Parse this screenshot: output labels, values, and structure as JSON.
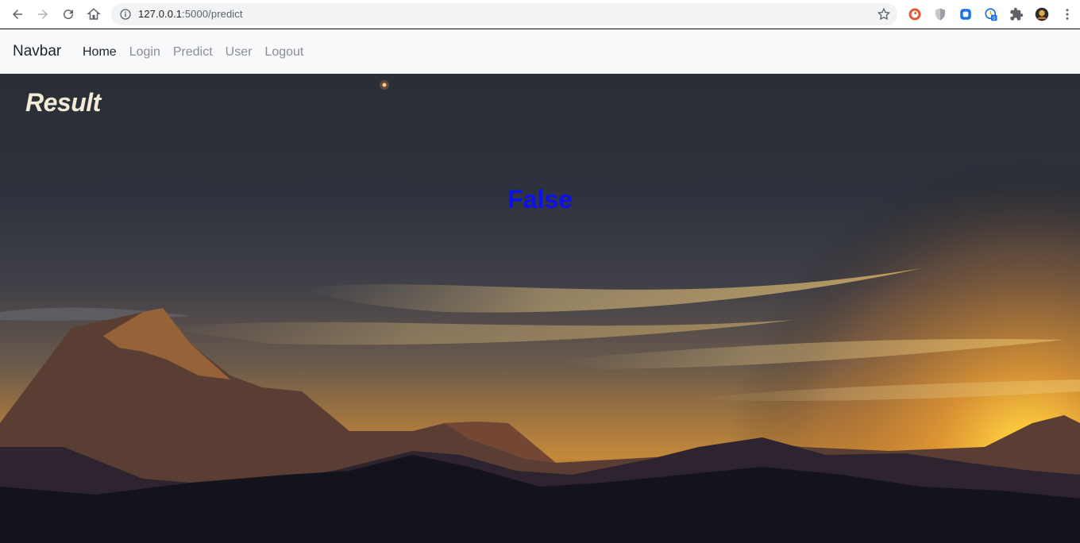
{
  "browser": {
    "url_host": "127.0.0.1",
    "url_path": ":5000/predict",
    "icons": {
      "back": "arrow-left-icon",
      "forward": "arrow-right-icon",
      "reload": "reload-icon",
      "home": "home-icon",
      "info": "info-icon",
      "bookmark": "star-icon"
    },
    "extensions": [
      "duckduckgo-icon",
      "shield-icon",
      "extension-blue-icon",
      "clock-badge-icon",
      "puzzle-icon",
      "avatar",
      "more-icon"
    ],
    "ext_badge": "0"
  },
  "navbar": {
    "brand": "Navbar",
    "links": [
      {
        "label": "Home",
        "active": true
      },
      {
        "label": "Login",
        "active": false
      },
      {
        "label": "Predict",
        "active": false
      },
      {
        "label": "User",
        "active": false
      },
      {
        "label": "Logout",
        "active": false
      }
    ]
  },
  "result": {
    "title": "Result",
    "value": "False",
    "value_color": "#0b10f2"
  }
}
